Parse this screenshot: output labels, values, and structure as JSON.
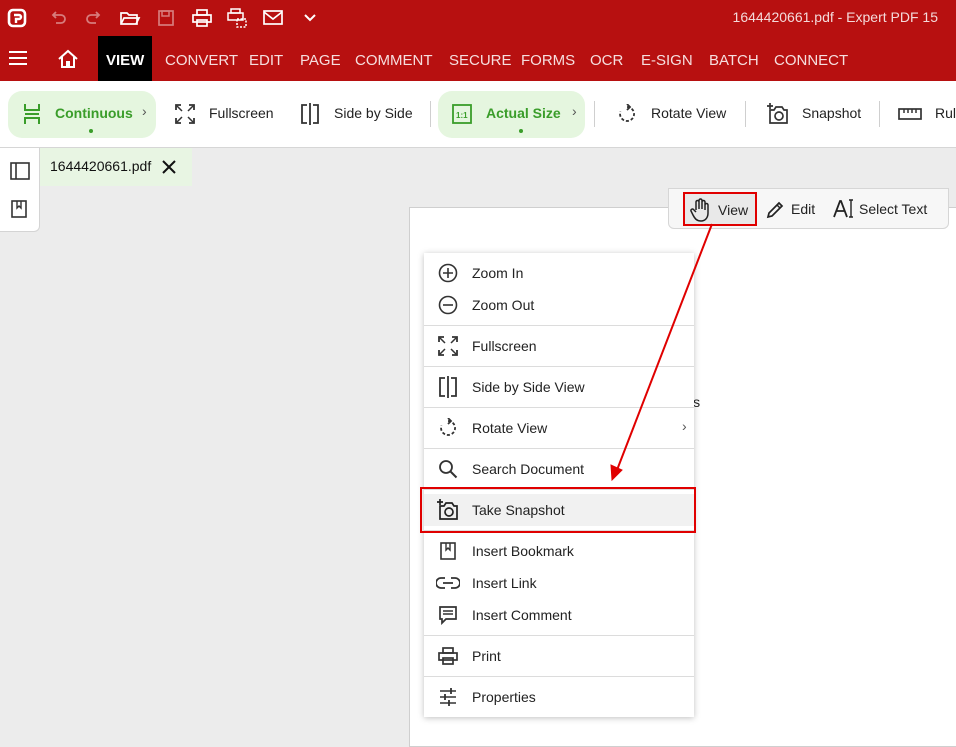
{
  "window": {
    "title": "1644420661.pdf  -  Expert PDF 15"
  },
  "menubar": {
    "tabs": [
      "VIEW",
      "CONVERT",
      "EDIT",
      "PAGE",
      "COMMENT",
      "SECURE",
      "FORMS",
      "OCR",
      "E-SIGN",
      "BATCH",
      "CONNECT"
    ],
    "active": "VIEW"
  },
  "ribbon": {
    "continuous": "Continuous",
    "fullscreen": "Fullscreen",
    "side_by_side": "Side by Side",
    "actual_size": "Actual Size",
    "rotate_view": "Rotate View",
    "snapshot": "Snapshot",
    "ruler": "Rul"
  },
  "document_tab": {
    "name": "1644420661.pdf"
  },
  "mode_toolbar": {
    "view": "View",
    "edit": "Edit",
    "select_text": "Select Text"
  },
  "page": {
    "visible_text": "is"
  },
  "context_menu": {
    "items": [
      "Zoom In",
      "Zoom Out",
      "Fullscreen",
      "Side by Side View",
      "Rotate View",
      "Search Document",
      "Take Snapshot",
      "Insert Bookmark",
      "Insert Link",
      "Insert Comment",
      "Print",
      "Properties"
    ],
    "highlighted": "Take Snapshot"
  },
  "annotation": {
    "color": "#e00000"
  },
  "colors": {
    "brand": "#b71010",
    "accent_green": "#3a9d2a",
    "active_tab": "#000000"
  }
}
